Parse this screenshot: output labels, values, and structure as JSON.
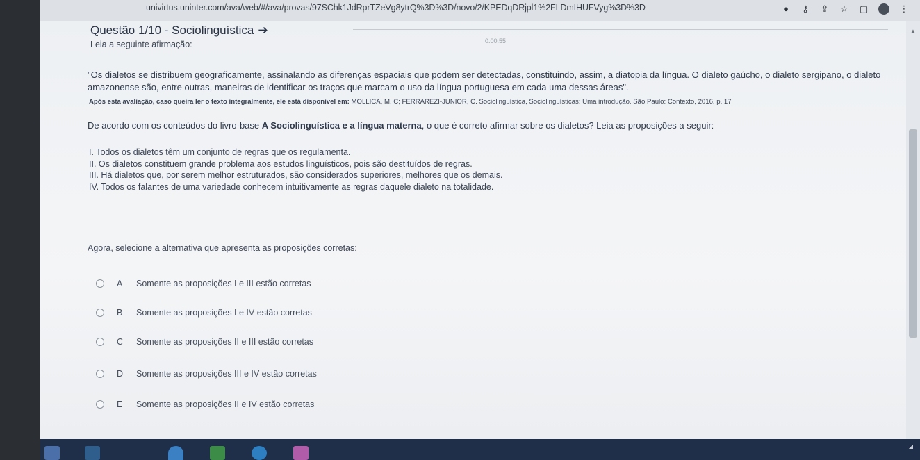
{
  "browser": {
    "url": "univirtus.uninter.com/ava/web/#/ava/provas/97SChk1JdRprTZeVg8ytrQ%3D%3D/novo/2/KPEDqDRjpl1%2FLDmIHUFVyg%3D%3D",
    "ghost_text": "0.00.55"
  },
  "question": {
    "title": "Questão 1/10 - Sociolinguística",
    "instruction": "Leia a seguinte afirmação:",
    "quote": "\"Os dialetos se distribuem geograficamente, assinalando as diferenças espaciais que podem ser detectadas, constituindo, assim, a diatopia da língua. O dialeto gaúcho, o dialeto sergipano, o dialeto amazonense são, entre outras, maneiras de identificar os traços que marcam o uso da língua portuguesa em cada uma dessas áreas\".",
    "source_intro": "Após esta avaliação, caso queira ler o texto integralmente, ele está disponível em:",
    "source_ref": "MOLLICA, M. C; FERRAREZI-JUNIOR, C. Sociolinguística, Sociolinguísticas: Uma introdução. São Paulo: Contexto, 2016. p. 17",
    "prompt_before": "De acordo com os conteúdos do livro-base ",
    "prompt_book": "A Sociolinguística e a língua materna",
    "prompt_after": ", o que é correto afirmar sobre os dialetos? Leia as proposições a seguir:",
    "propositions": [
      "I. Todos os dialetos têm um conjunto de regras que os regulamenta.",
      "II. Os dialetos constituem grande problema aos estudos linguísticos, pois são destituídos de regras.",
      "III. Há dialetos que, por serem melhor estruturados, são considerados superiores, melhores que os demais.",
      "IV. Todos os falantes de uma variedade conhecem intuitivamente as regras daquele dialeto na totalidade."
    ],
    "select_prompt": "Agora, selecione a alternativa que apresenta as proposições corretas:",
    "alternatives": [
      {
        "letter": "A",
        "text": "Somente as proposições I e III estão corretas"
      },
      {
        "letter": "B",
        "text": "Somente as proposições I e IV estão corretas"
      },
      {
        "letter": "C",
        "text": "Somente as proposições II e III estão corretas"
      },
      {
        "letter": "D",
        "text": "Somente as proposições III e IV estão corretas"
      },
      {
        "letter": "E",
        "text": "Somente as proposições II e IV estão corretas"
      }
    ]
  },
  "icons": {
    "title_arrow": "arrow-right-icon",
    "radio": "radio-button-icon"
  },
  "colors": {
    "text_dark": "#2f3a4d",
    "taskbar": "#1f2f4a"
  }
}
